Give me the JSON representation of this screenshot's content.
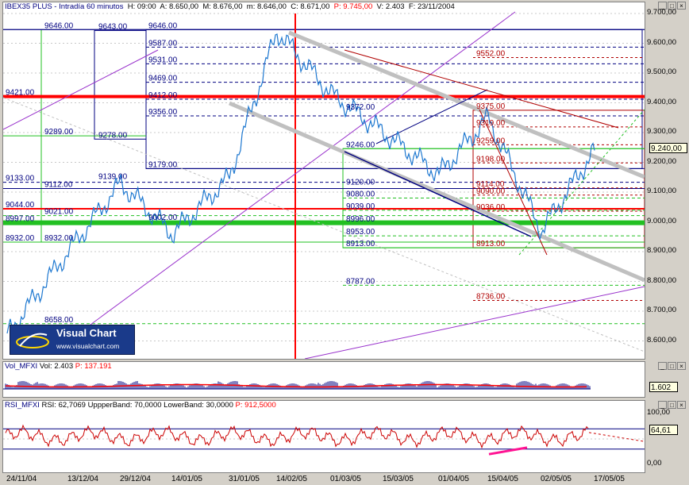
{
  "header": {
    "symbol": "IBEX35 PLUS - Intradía 60 minutos",
    "h_label": "H:",
    "h_value": "09:00",
    "a_label": "A:",
    "a_value": "8.650,00",
    "m_label": "M:",
    "m_value": "8.676,00",
    "mn_label": "m:",
    "mn_value": "8.646,00",
    "c_label": "C:",
    "c_value": "8.671,00",
    "p_label": "P:",
    "p_value": "9.745,00",
    "v_label": "V:",
    "v_value": "2.403",
    "f_label": "F:",
    "f_value": "23/11/2004"
  },
  "price_axis": {
    "ticks": [
      "9.700,00",
      "9.600,00",
      "9.500,00",
      "9.400,00",
      "9.300,00",
      "9.200,00",
      "9.100,00",
      "9.000,00",
      "8.900,00",
      "8.800,00",
      "8.700,00",
      "8.600,00"
    ],
    "last_value": "9.240,00"
  },
  "volume_panel": {
    "title": "Vol_MFXI",
    "vol_label": "Vol:",
    "vol_value": "2.403",
    "p_label": "P:",
    "p_value": "137.191",
    "last_value": "1.602"
  },
  "rsi_panel": {
    "title": "RSI_MFXI",
    "rsi_label": "RSI:",
    "rsi_value": "62,7069",
    "upper_label": "UppperBand:",
    "upper_value": "70,0000",
    "lower_label": "LowerBand:",
    "lower_value": "30,0000",
    "p_label": "P:",
    "p_value": "912,5000",
    "axis_top": "100,00",
    "axis_bottom": "0,00",
    "last_value": "64,61"
  },
  "x_axis": [
    "24/11/04",
    "13/12/04",
    "29/12/04",
    "14/01/05",
    "31/01/05",
    "14/02/05",
    "01/03/05",
    "15/03/05",
    "01/04/05",
    "15/04/05",
    "02/05/05",
    "17/05/05"
  ],
  "logo": {
    "title": "Visual Chart",
    "url": "www.visualchart.com"
  },
  "annotations": {
    "left_box": [
      "9646.00",
      "9421.00",
      "9289.00",
      "9133.00",
      "9112.00",
      "9044.00",
      "9021.00",
      "8997.00",
      "8932.00",
      "8932.00",
      "8658.00",
      "9139.00",
      "9002.00"
    ],
    "upper_box": [
      "9643.00",
      "9646.00",
      "9587.00",
      "9531.00",
      "9469.00",
      "9412.00",
      "9356.00",
      "9278.00",
      "9179.00"
    ],
    "middle_box": [
      "9372.00",
      "9246.00",
      "9120.00",
      "9080.00",
      "9039.00",
      "8996.00",
      "8953.00",
      "8913.00",
      "8787.00"
    ],
    "right_box": [
      "9552.00",
      "9375.00",
      "9319.00",
      "9259.00",
      "9198.00",
      "9114.00",
      "9090.00",
      "9036.00",
      "8913.00",
      "8736.00"
    ]
  },
  "colors": {
    "price_line": "#1e78d0",
    "red": "#ff0000",
    "green_support": "#22c022",
    "gray_channel": "#c0c0c0",
    "purple": "#9932cc",
    "navy": "#000080",
    "darkred": "#b00000",
    "rsi_line": "#cc0000",
    "magenta": "#ff1493"
  },
  "chart_data": {
    "type": "line",
    "title": "IBEX35 PLUS - Intradía 60 minutos",
    "x": [
      "24/11/04",
      "13/12/04",
      "29/12/04",
      "14/01/05",
      "31/01/05",
      "14/02/05",
      "01/03/05",
      "15/03/05",
      "01/04/05",
      "15/04/05",
      "02/05/05",
      "17/05/05"
    ],
    "series": [
      {
        "name": "IBEX35 PLUS",
        "values": [
          8620,
          8900,
          9130,
          8960,
          9150,
          9640,
          9430,
          9300,
          9160,
          9350,
          8970,
          9240
        ]
      }
    ],
    "ylim": [
      8540,
      9700
    ],
    "levels": [
      9646,
      9643,
      9587,
      9552,
      9531,
      9469,
      9421,
      9412,
      9375,
      9372,
      9356,
      9319,
      9289,
      9278,
      9259,
      9246,
      9198,
      9179,
      9139,
      9133,
      9120,
      9114,
      9112,
      9090,
      9080,
      9044,
      9039,
      9036,
      9021,
      9002,
      8997,
      8996,
      8953,
      8932,
      8913,
      8787,
      8736,
      8658
    ],
    "rsi": {
      "value": 62.7069,
      "upper_band": 70,
      "lower_band": 30,
      "ylim": [
        0,
        100
      ]
    },
    "volume": {
      "value": 2403,
      "last": 1602
    }
  }
}
